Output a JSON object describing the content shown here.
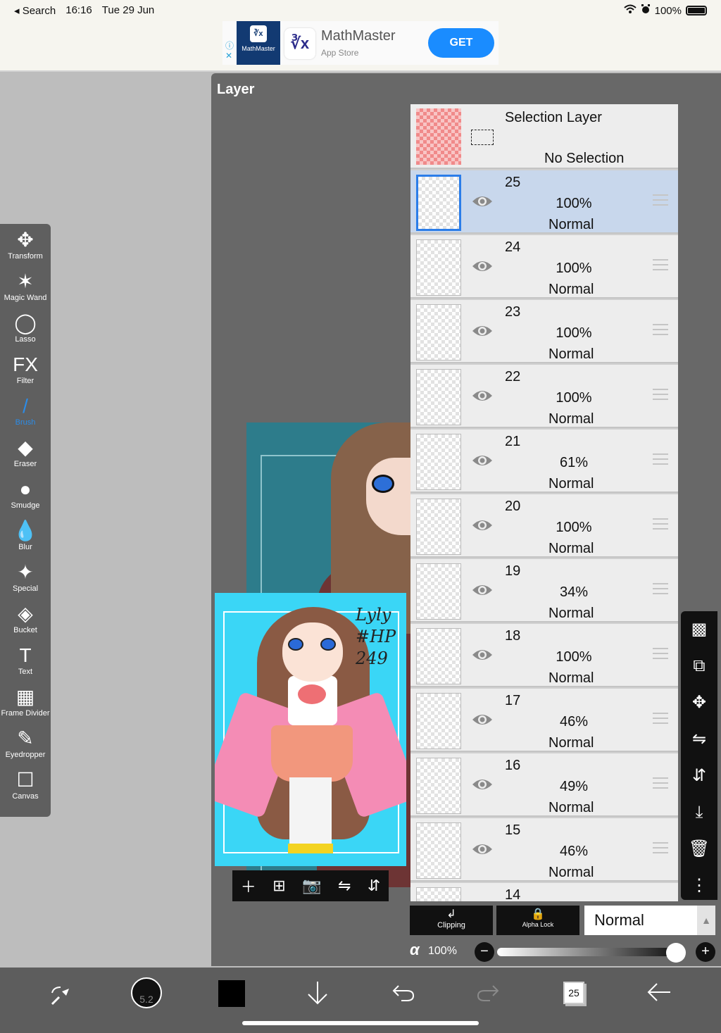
{
  "status_bar": {
    "back_app": "◂ Search",
    "time": "16:16",
    "date": "Tue 29 Jun",
    "battery": "100%"
  },
  "ad": {
    "title": "MathMaster",
    "subtitle": "App Store",
    "button": "GET",
    "icon_text": "∛x",
    "image_label": "MathMaster"
  },
  "toolbar": {
    "tools": [
      {
        "label": "Transform",
        "icon": "✥"
      },
      {
        "label": "Magic Wand",
        "icon": "✶"
      },
      {
        "label": "Lasso",
        "icon": "◯"
      },
      {
        "label": "Filter",
        "icon": "FX"
      },
      {
        "label": "Brush",
        "icon": "/"
      },
      {
        "label": "Eraser",
        "icon": "◆"
      },
      {
        "label": "Smudge",
        "icon": "●"
      },
      {
        "label": "Blur",
        "icon": "💧"
      },
      {
        "label": "Special",
        "icon": "✦"
      },
      {
        "label": "Bucket",
        "icon": "◈"
      },
      {
        "label": "Text",
        "icon": "T"
      },
      {
        "label": "Frame Divider",
        "icon": "▦"
      },
      {
        "label": "Eyedropper",
        "icon": "✎"
      },
      {
        "label": "Canvas",
        "icon": "☐"
      }
    ]
  },
  "panel": {
    "title": "Layer",
    "selection_layer": {
      "title": "Selection Layer",
      "status": "No Selection"
    },
    "layers": [
      {
        "number": "25",
        "opacity": "100%",
        "mode": "Normal",
        "selected": true
      },
      {
        "number": "24",
        "opacity": "100%",
        "mode": "Normal"
      },
      {
        "number": "23",
        "opacity": "100%",
        "mode": "Normal"
      },
      {
        "number": "22",
        "opacity": "100%",
        "mode": "Normal"
      },
      {
        "number": "21",
        "opacity": "61%",
        "mode": "Normal"
      },
      {
        "number": "20",
        "opacity": "100%",
        "mode": "Normal"
      },
      {
        "number": "19",
        "opacity": "34%",
        "mode": "Normal"
      },
      {
        "number": "18",
        "opacity": "100%",
        "mode": "Normal"
      },
      {
        "number": "17",
        "opacity": "46%",
        "mode": "Normal"
      },
      {
        "number": "16",
        "opacity": "49%",
        "mode": "Normal"
      },
      {
        "number": "15",
        "opacity": "46%",
        "mode": "Normal"
      },
      {
        "number": "14",
        "opacity": "",
        "mode": ""
      }
    ],
    "clipping_label": "Clipping",
    "alpha_lock_label": "Alpha Lock",
    "blend_mode": "Normal",
    "alpha_symbol": "α",
    "alpha_value": "100%",
    "alpha_level": 1.0
  },
  "thumbnail": {
    "signature_line1": "Lyly",
    "signature_line2": "#HP",
    "signature_line3": "249"
  },
  "bottom_bar": {
    "brush_size": "5.2",
    "page_count": "25",
    "color": "#000000"
  },
  "colors": {
    "accent": "#2b8ce8",
    "panel_bg": "#686868",
    "selected_row": "#c8d7ec",
    "ad_button": "#1a8cff"
  }
}
